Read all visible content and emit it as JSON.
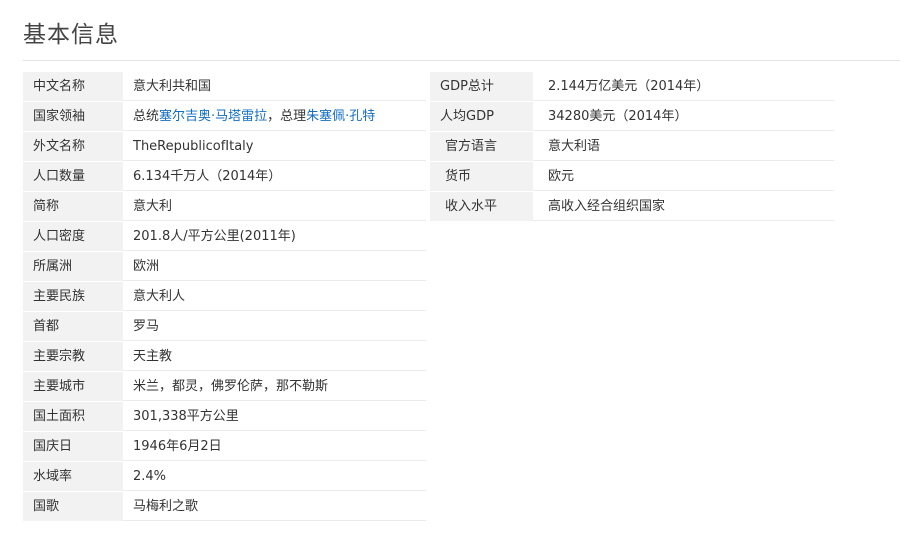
{
  "title": "基本信息",
  "left_rows": [
    {
      "label": "中文名称",
      "value": "意大利共和国"
    },
    {
      "label": "国家领袖",
      "value": ""
    },
    {
      "label": "外文名称",
      "value": "TheRepublicofItaly"
    },
    {
      "label": "人口数量",
      "value": "6.134千万人（2014年）"
    },
    {
      "label": "简称",
      "value": "意大利"
    },
    {
      "label": "人口密度",
      "value": "201.8人/平方公里(2011年)"
    },
    {
      "label": "所属洲",
      "value": "欧洲"
    },
    {
      "label": "主要民族",
      "value": "意大利人"
    },
    {
      "label": "首都",
      "value": "罗马"
    },
    {
      "label": "主要宗教",
      "value": "天主教"
    },
    {
      "label": "主要城市",
      "value": "米兰，都灵，佛罗伦萨，那不勒斯"
    },
    {
      "label": "国土面积",
      "value": "301,338平方公里"
    },
    {
      "label": "国庆日",
      "value": "1946年6月2日"
    },
    {
      "label": "水域率",
      "value": "2.4%"
    },
    {
      "label": "国歌",
      "value": "马梅利之歌"
    }
  ],
  "leaders": {
    "prefix1": "总统",
    "president_link": "塞尔吉奥·马塔雷拉",
    "sep": "，总理",
    "pm_link": "朱塞佩·孔特"
  },
  "right_rows": [
    {
      "label": "GDP总计",
      "value": "2.144万亿美元（2014年）"
    },
    {
      "label": "人均GDP",
      "value": "34280美元（2014年）"
    },
    {
      "label": "官方语言",
      "value": "意大利语"
    },
    {
      "label": "货币",
      "value": "欧元"
    },
    {
      "label": "收入水平",
      "value": "高收入经合组织国家"
    }
  ],
  "colors": {
    "label_bg": "#f2f2f2",
    "link": "#136ec2",
    "text": "#333333"
  }
}
